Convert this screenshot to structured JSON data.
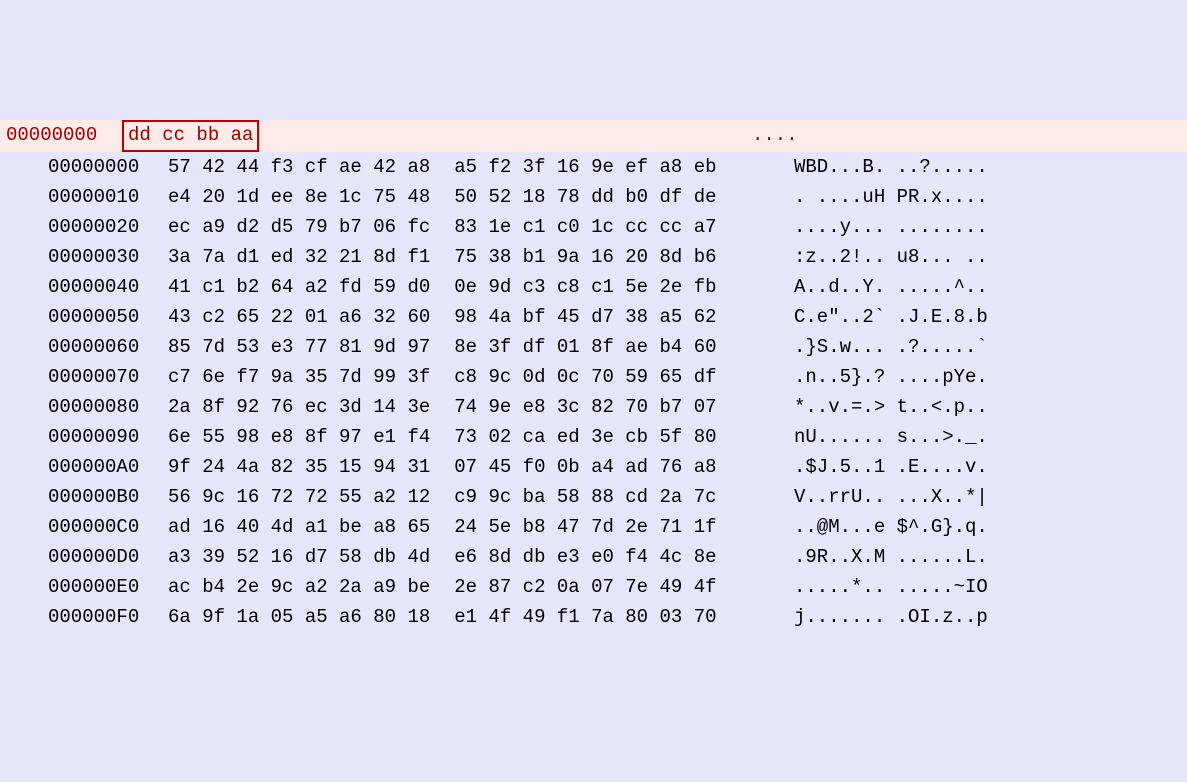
{
  "header": {
    "offset": "00000000",
    "hex_box": "dd cc bb aa",
    "ascii": "...."
  },
  "rows": [
    {
      "offset": "00000000",
      "h1": "57 42 44 f3 cf ae 42 a8",
      "h2": "a5 f2 3f 16 9e ef a8 eb",
      "ascii": "WBD...B. ..?....."
    },
    {
      "offset": "00000010",
      "h1": "e4 20 1d ee 8e 1c 75 48",
      "h2": "50 52 18 78 dd b0 df de",
      "ascii": ". ....uH PR.x...."
    },
    {
      "offset": "00000020",
      "h1": "ec a9 d2 d5 79 b7 06 fc",
      "h2": "83 1e c1 c0 1c cc cc a7",
      "ascii": "....y... ........"
    },
    {
      "offset": "00000030",
      "h1": "3a 7a d1 ed 32 21 8d f1",
      "h2": "75 38 b1 9a 16 20 8d b6",
      "ascii": ":z..2!.. u8... .."
    },
    {
      "offset": "00000040",
      "h1": "41 c1 b2 64 a2 fd 59 d0",
      "h2": "0e 9d c3 c8 c1 5e 2e fb",
      "ascii": "A..d..Y. .....^.."
    },
    {
      "offset": "00000050",
      "h1": "43 c2 65 22 01 a6 32 60",
      "h2": "98 4a bf 45 d7 38 a5 62",
      "ascii": "C.e\"..2` .J.E.8.b"
    },
    {
      "offset": "00000060",
      "h1": "85 7d 53 e3 77 81 9d 97",
      "h2": "8e 3f df 01 8f ae b4 60",
      "ascii": ".}S.w... .?.....`"
    },
    {
      "offset": "00000070",
      "h1": "c7 6e f7 9a 35 7d 99 3f",
      "h2": "c8 9c 0d 0c 70 59 65 df",
      "ascii": ".n..5}.? ....pYe."
    },
    {
      "offset": "00000080",
      "h1": "2a 8f 92 76 ec 3d 14 3e",
      "h2": "74 9e e8 3c 82 70 b7 07",
      "ascii": "*..v.=.> t..<.p.."
    },
    {
      "offset": "00000090",
      "h1": "6e 55 98 e8 8f 97 e1 f4",
      "h2": "73 02 ca ed 3e cb 5f 80",
      "ascii": "nU...... s...>._."
    },
    {
      "offset": "000000A0",
      "h1": "9f 24 4a 82 35 15 94 31",
      "h2": "07 45 f0 0b a4 ad 76 a8",
      "ascii": ".$J.5..1 .E....v."
    },
    {
      "offset": "000000B0",
      "h1": "56 9c 16 72 72 55 a2 12",
      "h2": "c9 9c ba 58 88 cd 2a 7c",
      "ascii": "V..rrU.. ...X..*|"
    },
    {
      "offset": "000000C0",
      "h1": "ad 16 40 4d a1 be a8 65",
      "h2": "24 5e b8 47 7d 2e 71 1f",
      "ascii": "..@M...e $^.G}.q."
    },
    {
      "offset": "000000D0",
      "h1": "a3 39 52 16 d7 58 db 4d",
      "h2": "e6 8d db e3 e0 f4 4c 8e",
      "ascii": ".9R..X.M ......L."
    },
    {
      "offset": "000000E0",
      "h1": "ac b4 2e 9c a2 2a a9 be",
      "h2": "2e 87 c2 0a 07 7e 49 4f",
      "ascii": ".....*.. .....~IO"
    },
    {
      "offset": "000000F0",
      "h1": "6a 9f 1a 05 a5 a6 80 18",
      "h2": "e1 4f 49 f1 7a 80 03 70",
      "ascii": "j....... .OI.z..p"
    }
  ]
}
